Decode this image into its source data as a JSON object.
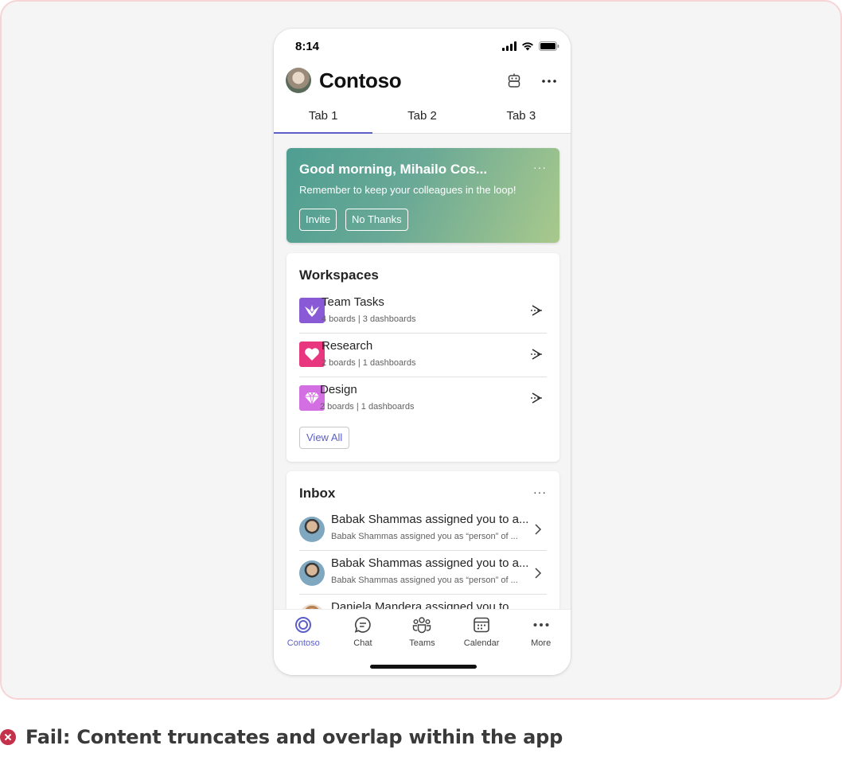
{
  "status": {
    "time": "8:14"
  },
  "header": {
    "title": "Contoso"
  },
  "tabs": [
    {
      "label": "Tab 1",
      "active": true
    },
    {
      "label": "Tab 2",
      "active": false
    },
    {
      "label": "Tab 3",
      "active": false
    }
  ],
  "hero": {
    "title": "Good morning, Mihailo Cos...",
    "subtitle": "Remember to keep your colleagues in the loop!",
    "more": "···",
    "invite_label": "Invite",
    "no_thanks_label": "No Thanks"
  },
  "workspaces": {
    "title": "Workspaces",
    "items": [
      {
        "name": "Team Tasks",
        "meta": "4 boards | 3 dashboards",
        "icon": "crane-icon",
        "color": "#8a5ad6"
      },
      {
        "name": "Research",
        "meta": "2 boards | 1 dashboards",
        "icon": "heart-icon",
        "color": "#e8367f"
      },
      {
        "name": "Design",
        "meta": "2 boards | 1 dashboards",
        "icon": "diamond-icon",
        "color": "#d46fe3"
      }
    ],
    "view_all_label": "View All"
  },
  "inbox": {
    "title": "Inbox",
    "more": "···",
    "items": [
      {
        "title": "Babak Shammas assigned you to a...",
        "subtitle": "Babak Shammas assigned you as “person” of ..."
      },
      {
        "title": "Babak Shammas assigned you to a...",
        "subtitle": "Babak Shammas assigned you as “person” of ..."
      },
      {
        "title": "Daniela Mandera assigned you to...",
        "subtitle": ""
      }
    ]
  },
  "nav": [
    {
      "label": "Contoso",
      "icon": "contoso-icon",
      "active": true
    },
    {
      "label": "Chat",
      "icon": "chat-icon",
      "active": false
    },
    {
      "label": "Teams",
      "icon": "teams-icon",
      "active": false
    },
    {
      "label": "Calendar",
      "icon": "calendar-icon",
      "active": false
    },
    {
      "label": "More",
      "icon": "more-icon",
      "active": false
    }
  ],
  "caption": {
    "text": "Fail: Content truncates and overlap within the app"
  },
  "colors": {
    "accent": "#5b5fc7",
    "fail": "#c4314b",
    "frame_border": "#f7d4d6"
  }
}
